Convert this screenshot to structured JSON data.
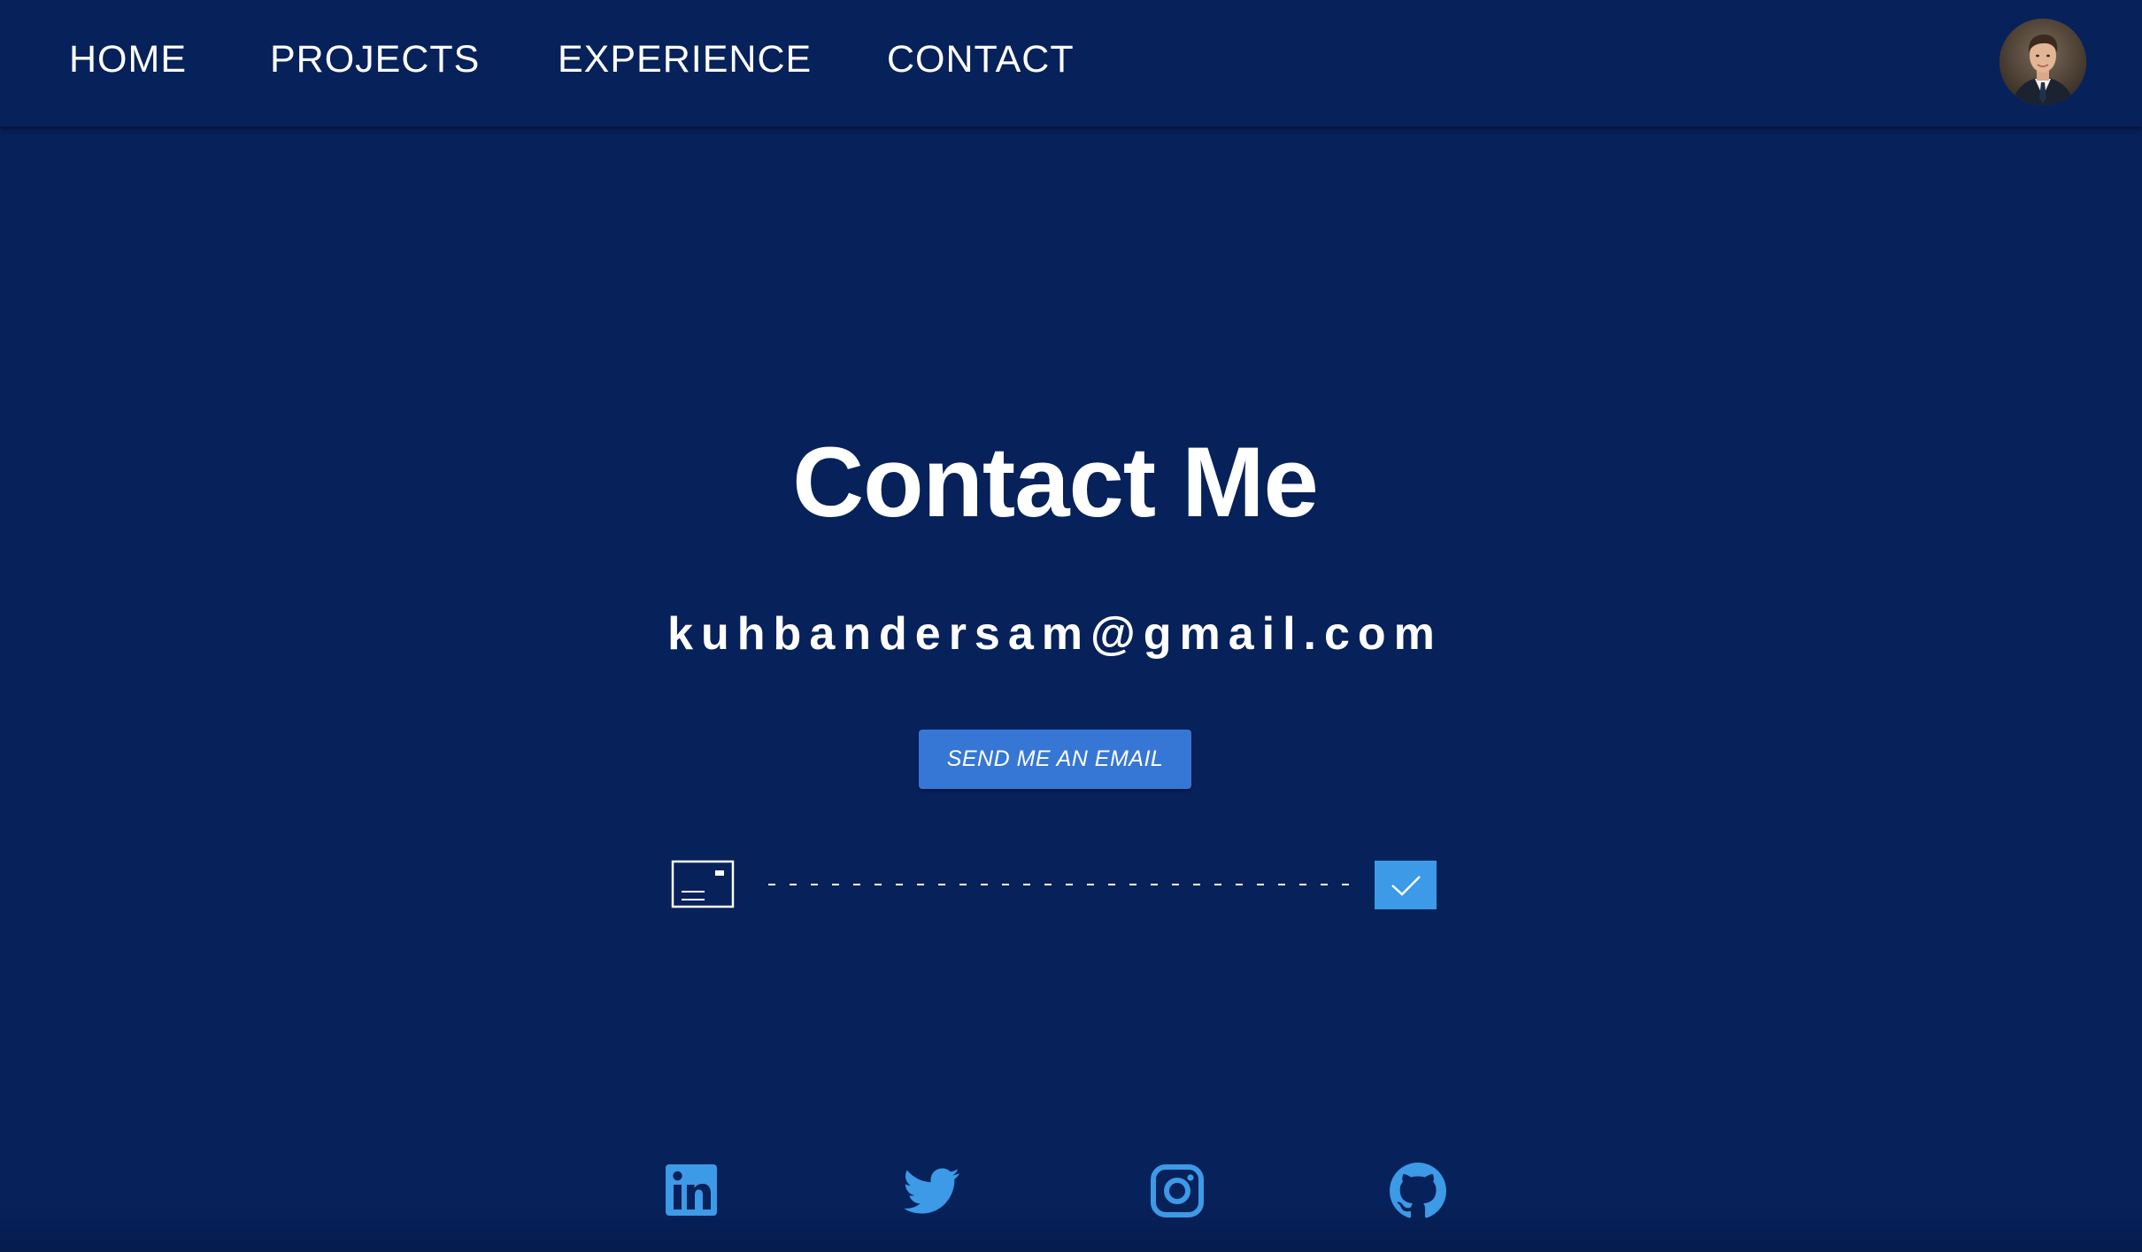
{
  "nav": {
    "links": [
      {
        "label": "HOME"
      },
      {
        "label": "PROJECTS"
      },
      {
        "label": "EXPERIENCE"
      },
      {
        "label": "CONTACT"
      }
    ],
    "avatar_icon": "profile-photo"
  },
  "main": {
    "title": "Contact Me",
    "email": "kuhbandersam@gmail.com",
    "send_button_label": "SEND ME AN EMAIL",
    "animation_icons": [
      "envelope-icon",
      "dashed-line",
      "check-icon"
    ]
  },
  "social": {
    "icons": [
      "linkedin-icon",
      "twitter-icon",
      "instagram-icon",
      "github-icon"
    ]
  },
  "colors": {
    "background": "#07215a",
    "button": "#3677d5",
    "accent": "#3c9ae6",
    "text": "#ffffff"
  }
}
